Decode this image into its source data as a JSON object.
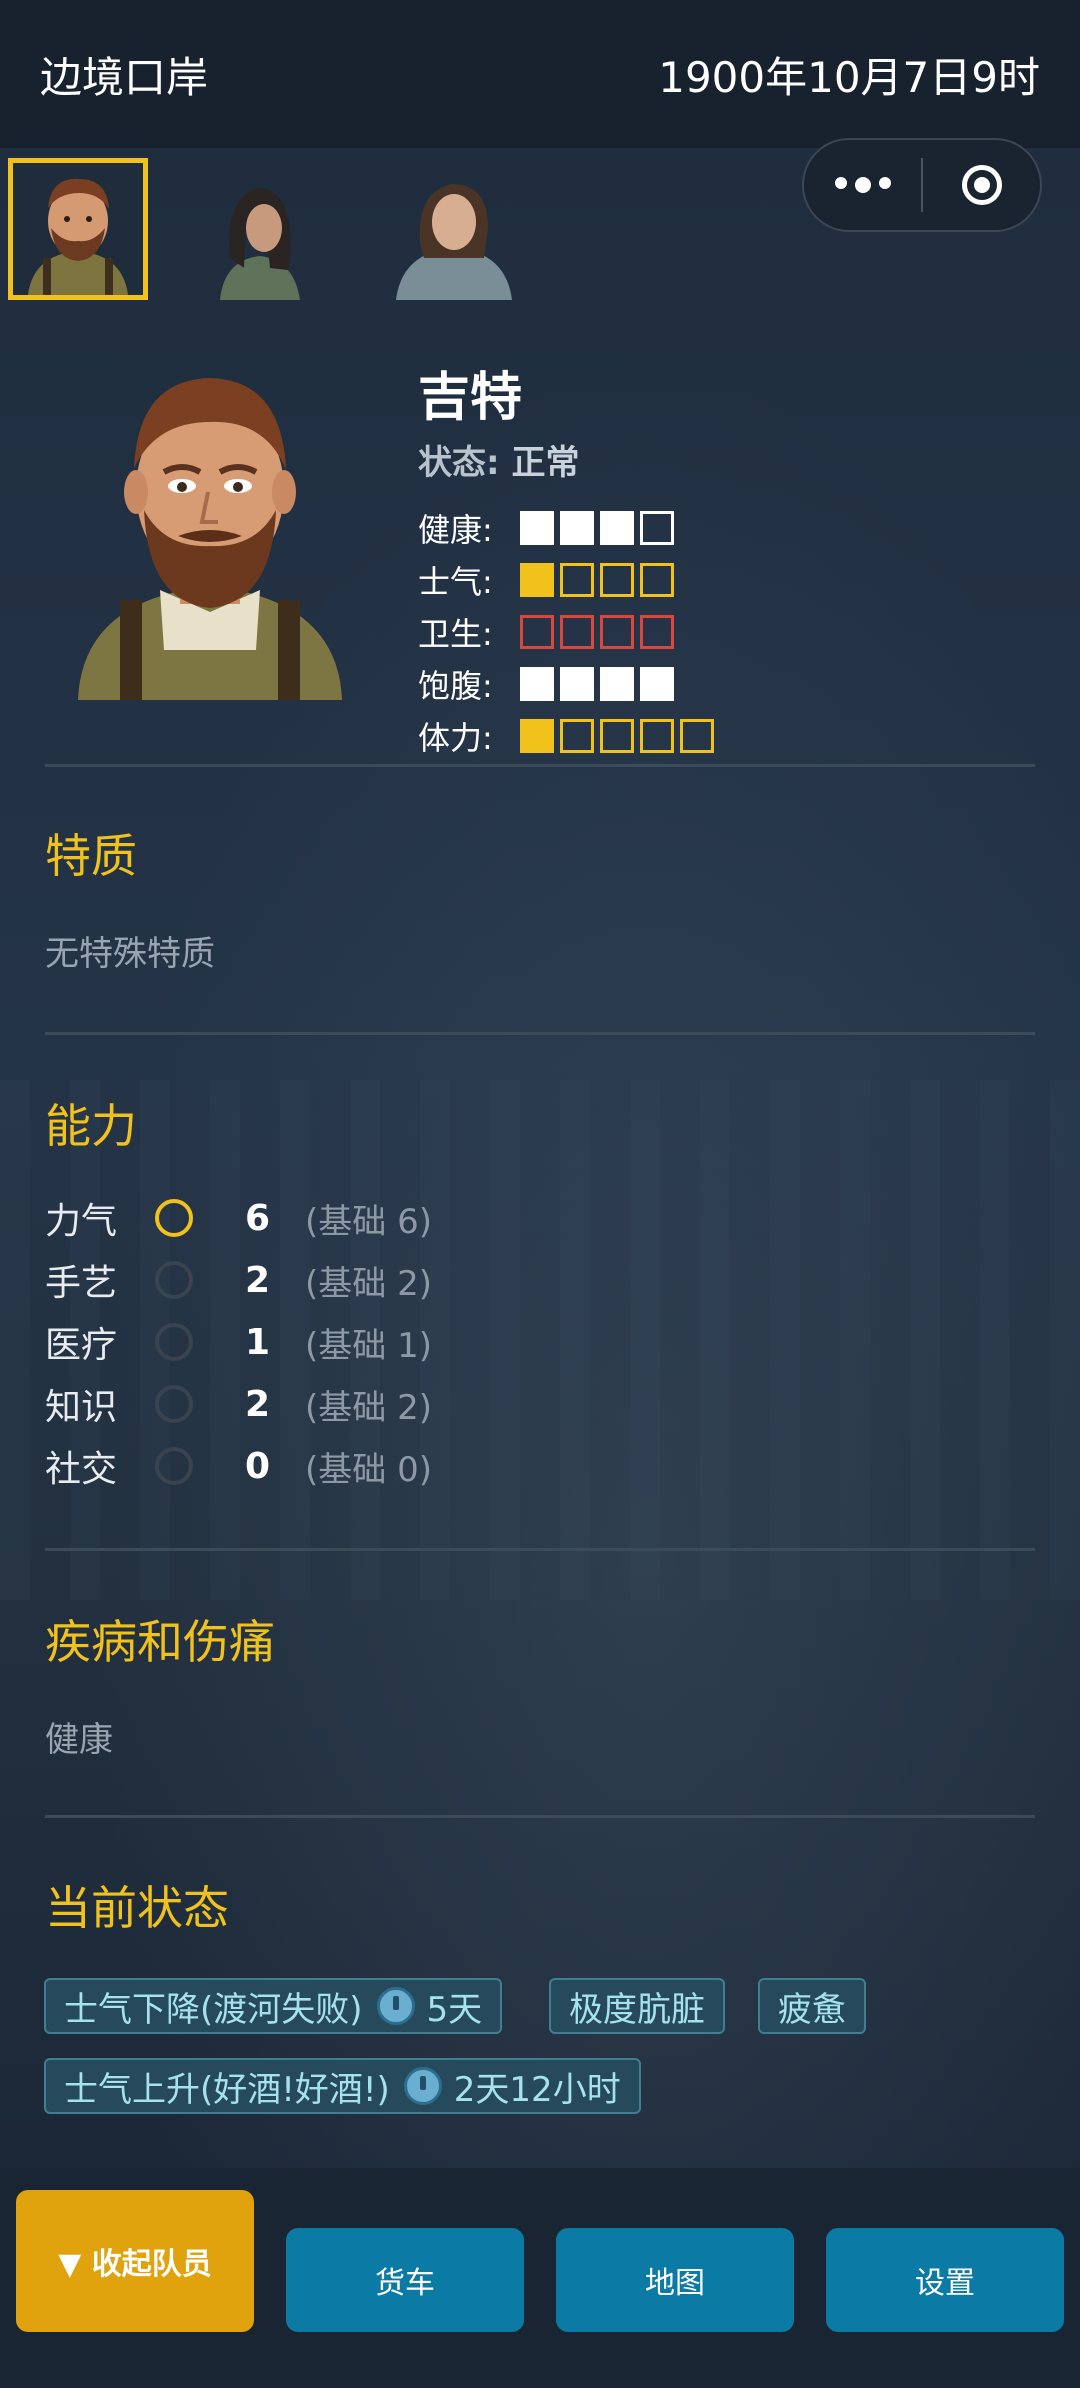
{
  "header": {
    "location": "边境口岸",
    "datetime": "1900年10月7日9时"
  },
  "party": [
    {
      "name": "吉特",
      "selected": true,
      "icon": "bearded-man-portrait"
    },
    {
      "name": "",
      "selected": false,
      "icon": "dark-hair-girl-portrait"
    },
    {
      "name": "",
      "selected": false,
      "icon": "shawl-woman-portrait"
    }
  ],
  "character": {
    "name": "吉特",
    "status_label": "状态:",
    "status_value": "正常",
    "stats": [
      {
        "label": "健康:",
        "filled": 3,
        "max": 4,
        "color": "#ffffff"
      },
      {
        "label": "士气:",
        "filled": 1,
        "max": 4,
        "color": "#f1c21b"
      },
      {
        "label": "卫生:",
        "filled": 0,
        "max": 4,
        "color": "#d9473f"
      },
      {
        "label": "饱腹:",
        "filled": 4,
        "max": 4,
        "color": "#ffffff"
      },
      {
        "label": "体力:",
        "filled": 1,
        "max": 5,
        "color": "#f1c21b"
      }
    ]
  },
  "traits": {
    "title": "特质",
    "text": "无特殊特质"
  },
  "abilities": {
    "title": "能力",
    "items": [
      {
        "name": "力气",
        "value": "6",
        "base": "(基础 6)",
        "highlight": true
      },
      {
        "name": "手艺",
        "value": "2",
        "base": "(基础 2)",
        "highlight": false
      },
      {
        "name": "医疗",
        "value": "1",
        "base": "(基础 1)",
        "highlight": false
      },
      {
        "name": "知识",
        "value": "2",
        "base": "(基础 2)",
        "highlight": false
      },
      {
        "name": "社交",
        "value": "0",
        "base": "(基础 0)",
        "highlight": false
      }
    ]
  },
  "injuries": {
    "title": "疾病和伤痛",
    "text": "健康"
  },
  "current_status": {
    "title": "当前状态",
    "tags": [
      {
        "text": "士气下降(渡河失败)",
        "duration": "5天"
      },
      {
        "text": "极度肮脏",
        "duration": ""
      },
      {
        "text": "疲惫",
        "duration": ""
      },
      {
        "text": "士气上升(好酒!好酒!)",
        "duration": "2天12小时"
      }
    ]
  },
  "bottom_nav": {
    "collapse": "▼ 收起队员",
    "truck": "货车",
    "map": "地图",
    "settings": "设置"
  },
  "colors": {
    "accent": "#f1c21b",
    "button": "#0b7aa5",
    "collapse": "#e0a20d",
    "tag_bg": "#264a5c"
  }
}
